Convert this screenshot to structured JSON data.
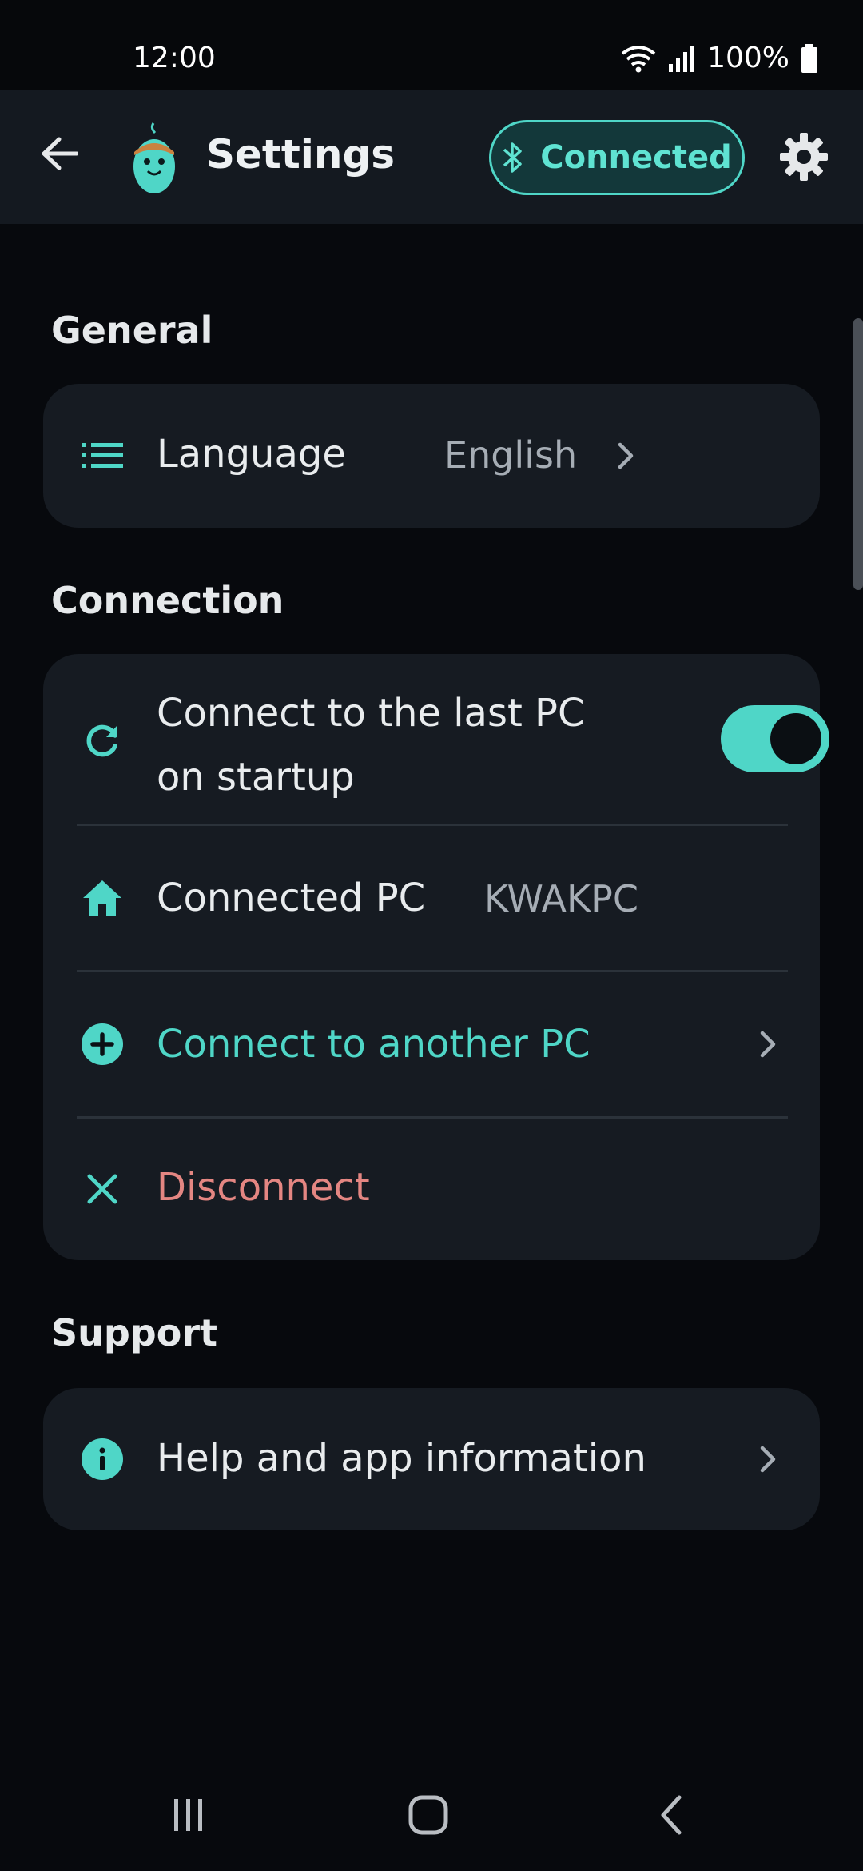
{
  "status": {
    "time": "12:00",
    "battery": "100%"
  },
  "appbar": {
    "title": "Settings",
    "connection_label": "Connected"
  },
  "sections": {
    "general": {
      "title": "General"
    },
    "connection": {
      "title": "Connection"
    },
    "support": {
      "title": "Support"
    }
  },
  "general": {
    "language": {
      "label": "Language",
      "value": "English"
    }
  },
  "connection": {
    "auto_connect": {
      "label_line1": "Connect to the last PC",
      "label_line2": "on startup",
      "enabled": true
    },
    "connected_pc": {
      "label": "Connected PC",
      "value": "KWAKPC"
    },
    "connect_another": {
      "label": "Connect to another PC"
    },
    "disconnect": {
      "label": "Disconnect"
    }
  },
  "support": {
    "help": {
      "label": "Help and app information"
    }
  },
  "colors": {
    "accent": "#4fd6c7",
    "danger": "#e48682",
    "card": "#161b22",
    "background": "#07090d"
  },
  "icons": {
    "back": "arrow-left-icon",
    "logo": "mouse-mascot-icon",
    "bluetooth": "bluetooth-icon",
    "settings": "gear-icon",
    "language": "list-icon",
    "auto_connect": "refresh-icon",
    "connected_pc": "home-icon",
    "connect_another": "plus-circle-icon",
    "disconnect": "close-icon",
    "help": "info-icon"
  }
}
